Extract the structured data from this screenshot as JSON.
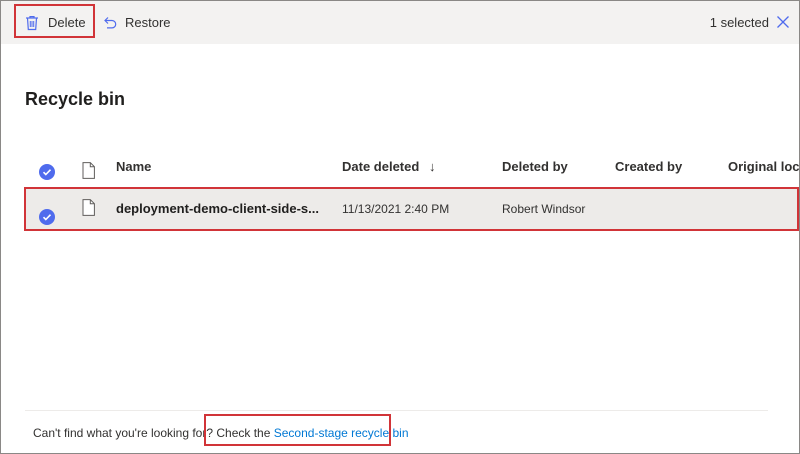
{
  "toolbar": {
    "delete_label": "Delete",
    "restore_label": "Restore",
    "selected_text": "1 selected",
    "icons": {
      "delete": "trash-icon",
      "restore": "undo-icon",
      "close": "close-icon"
    }
  },
  "page": {
    "title": "Recycle bin"
  },
  "list": {
    "columns": {
      "name": "Name",
      "date_deleted": "Date deleted",
      "sort_indicator": "↓",
      "deleted_by": "Deleted by",
      "created_by": "Created by",
      "original_location": "Original loc"
    },
    "rows": [
      {
        "name": "deployment-demo-client-side-s...",
        "date_deleted": "11/13/2021 2:40 PM",
        "deleted_by": "Robert Windsor",
        "created_by": "",
        "original_location": "",
        "selected": true
      }
    ]
  },
  "footer": {
    "prompt_text": "Can't find what you're looking for?",
    "check_text": "Check the",
    "link_text": "Second-stage recycle bin"
  },
  "colors": {
    "accent": "#4f6bed",
    "link": "#0078d4",
    "highlight": "#d13438"
  }
}
